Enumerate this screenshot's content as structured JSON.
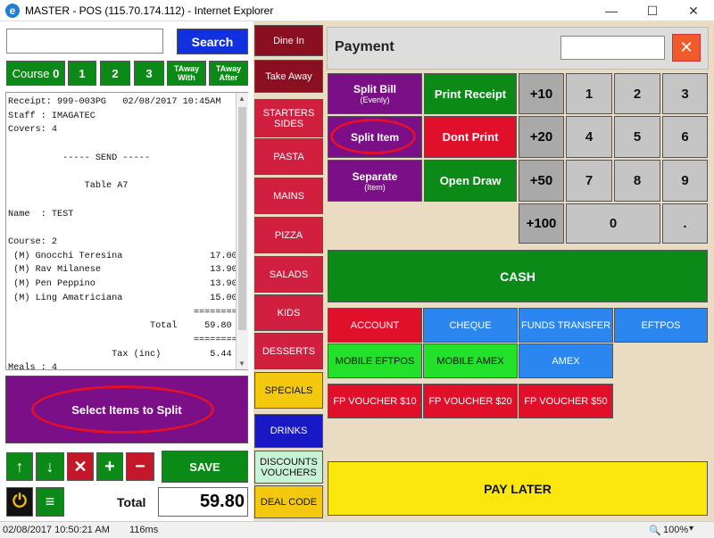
{
  "window": {
    "title": "MASTER - POS (115.70.174.112) - Internet Explorer",
    "minimize": "—",
    "maximize": "☐",
    "close": "✕"
  },
  "search": {
    "value": "",
    "button": "Search"
  },
  "courses": {
    "course0_prefix": "Course",
    "course0_num": "0",
    "c1": "1",
    "c2": "2",
    "c3": "3",
    "taway_with_1": "TAway",
    "taway_with_2": "With",
    "taway_after_1": "TAway",
    "taway_after_2": "After"
  },
  "receipt": {
    "lines": [
      "Receipt: 999-003PG   02/08/2017 10:45AM",
      "Staff : IMAGATEC",
      "Covers: 4",
      "",
      "          ----- SEND -----",
      "",
      "              Table A7",
      "",
      "Name  : TEST",
      "",
      "Course: 2",
      " (M) Gnocchi Teresina                17.00",
      " (M) Rav Milanese                    13.90",
      " (M) Pen Peppino                     13.90",
      " (M) Ling Amatriciana                15.00",
      "                                  ========",
      "                          Total     59.80",
      "                                  ========",
      "                   Tax (inc)         5.44",
      "Meals : 4"
    ]
  },
  "select_items": "Select Items to Split",
  "actions": {
    "up": "↑",
    "down": "↓",
    "delete": "✕",
    "plus": "+",
    "minus": "−",
    "save": "SAVE",
    "power": "⏻",
    "menu": "≡"
  },
  "total": {
    "label": "Total",
    "value": "59.80"
  },
  "categories": [
    "Dine In",
    "Take Away",
    "STARTERS SIDES",
    "PASTA",
    "MAINS",
    "PIZZA",
    "SALADS",
    "KIDS",
    "DESSERTS",
    "SPECIALS",
    "DRINKS",
    "DISCOUNTS VOUCHERS",
    "DEAL CODE"
  ],
  "payment": {
    "title": "Payment",
    "input_value": "",
    "close": "✕",
    "split_bill": "Split Bill",
    "split_bill_sub": "(Evenly)",
    "split_item": "Split Item",
    "separate": "Separate",
    "separate_sub": "(Item)",
    "print_receipt": "Print Receipt",
    "dont_print": "Dont Print",
    "open_draw": "Open Draw",
    "plus10": "+10",
    "plus20": "+20",
    "plus50": "+50",
    "plus100": "+100",
    "keys": [
      "1",
      "2",
      "3",
      "4",
      "5",
      "6",
      "7",
      "8",
      "9",
      "0",
      "."
    ],
    "cash": "CASH",
    "account": "ACCOUNT",
    "cheque": "CHEQUE",
    "funds_transfer": "FUNDS TRANSFER",
    "eftpos": "EFTPOS",
    "mobile_eftpos": "MOBILE EFTPOS",
    "mobile_amex": "MOBILE AMEX",
    "amex": "AMEX",
    "fp10": "FP VOUCHER $10",
    "fp20": "FP VOUCHER $20",
    "fp50": "FP VOUCHER $50",
    "pay_later": "PAY LATER"
  },
  "status": {
    "datetime": "02/08/2017 10:50:21 AM",
    "timing": "116ms",
    "zoom": "100%"
  },
  "colors": {
    "accent_red": "#e0102a",
    "green": "#0c8a18",
    "purple": "#7b0f87"
  }
}
